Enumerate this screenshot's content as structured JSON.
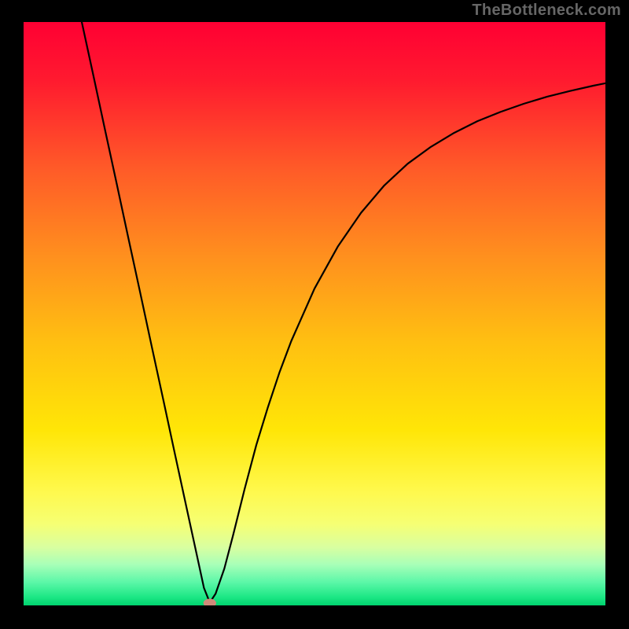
{
  "watermark": "TheBottleneck.com",
  "chart_data": {
    "type": "line",
    "title": "",
    "xlabel": "",
    "ylabel": "",
    "xlim": [
      0,
      100
    ],
    "ylim": [
      0,
      100
    ],
    "grid": false,
    "legend": null,
    "background_gradient": {
      "type": "vertical",
      "stops": [
        {
          "pos": 0.0,
          "color": "#ff0033"
        },
        {
          "pos": 0.1,
          "color": "#ff1a2f"
        },
        {
          "pos": 0.25,
          "color": "#ff5a28"
        },
        {
          "pos": 0.4,
          "color": "#ff8f1e"
        },
        {
          "pos": 0.55,
          "color": "#ffc011"
        },
        {
          "pos": 0.7,
          "color": "#ffe607"
        },
        {
          "pos": 0.8,
          "color": "#fff84a"
        },
        {
          "pos": 0.86,
          "color": "#f6ff73"
        },
        {
          "pos": 0.9,
          "color": "#d9ffa0"
        },
        {
          "pos": 0.93,
          "color": "#a8ffb8"
        },
        {
          "pos": 0.96,
          "color": "#5cf7a8"
        },
        {
          "pos": 0.985,
          "color": "#1ee886"
        },
        {
          "pos": 1.0,
          "color": "#00d36f"
        }
      ]
    },
    "series": [
      {
        "name": "bottleneck-curve",
        "color": "#000000",
        "width": 2.2,
        "x": [
          10.0,
          12.0,
          14.0,
          16.0,
          18.0,
          20.0,
          22.0,
          24.0,
          26.0,
          28.0,
          29.5,
          31.0,
          32.0,
          33.0,
          34.5,
          36.0,
          38.0,
          40.0,
          42.0,
          44.0,
          46.0,
          50.0,
          54.0,
          58.0,
          62.0,
          66.0,
          70.0,
          74.0,
          78.0,
          82.0,
          86.0,
          90.0,
          94.0,
          98.0,
          100.0
        ],
        "y": [
          100.0,
          90.8,
          81.5,
          72.3,
          63.0,
          53.8,
          44.5,
          35.3,
          26.0,
          16.8,
          9.9,
          3.0,
          0.5,
          2.0,
          6.3,
          12.0,
          20.0,
          27.5,
          34.0,
          40.0,
          45.3,
          54.3,
          61.5,
          67.3,
          72.0,
          75.7,
          78.6,
          81.0,
          83.0,
          84.6,
          86.0,
          87.2,
          88.2,
          89.1,
          89.5
        ]
      }
    ],
    "marker": {
      "name": "optimum-point",
      "x": 32.0,
      "y": 0.4,
      "rx": 1.1,
      "ry": 0.75,
      "color": "#cf8a7a"
    }
  }
}
